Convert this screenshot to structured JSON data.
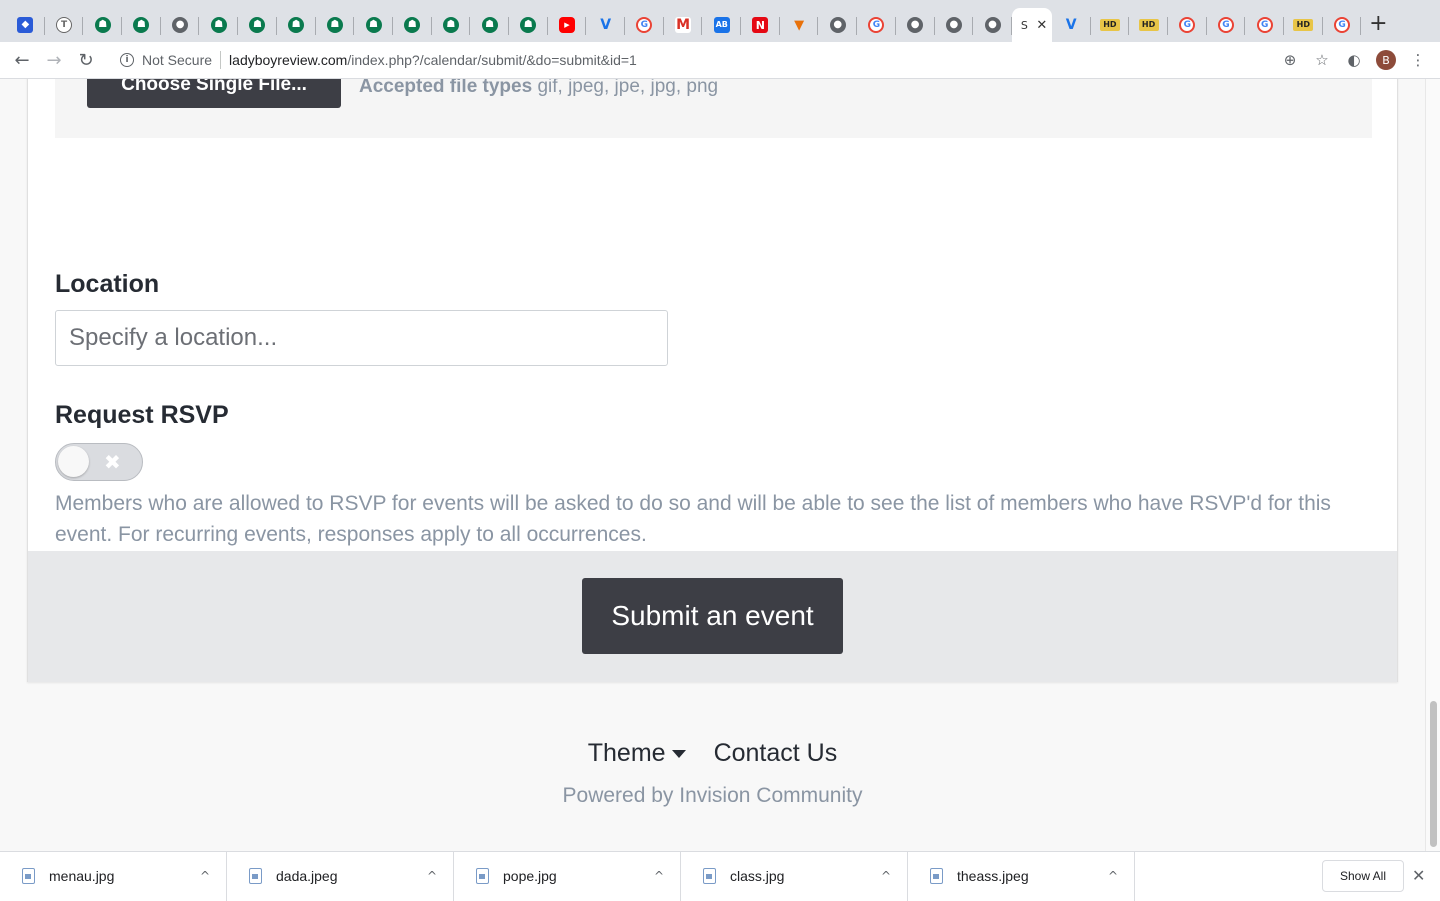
{
  "browser": {
    "tabs": [
      {
        "icon": "app-icon",
        "glyph": "◆",
        "style": "fav-blue"
      },
      {
        "icon": "t-icon",
        "glyph": "T",
        "style": "fav-t"
      },
      {
        "icon": "green-logo-icon",
        "glyph": "☗",
        "style": "fav-circle-green"
      },
      {
        "icon": "green-logo-icon",
        "glyph": "☗",
        "style": "fav-circle-green"
      },
      {
        "icon": "globe-icon",
        "glyph": "●",
        "style": "fav-globe"
      },
      {
        "icon": "green-logo-icon",
        "glyph": "☗",
        "style": "fav-circle-green"
      },
      {
        "icon": "green-logo-icon",
        "glyph": "☗",
        "style": "fav-circle-green"
      },
      {
        "icon": "green-logo-icon",
        "glyph": "☗",
        "style": "fav-circle-green"
      },
      {
        "icon": "green-logo-icon",
        "glyph": "☗",
        "style": "fav-circle-green"
      },
      {
        "icon": "green-logo-icon",
        "glyph": "☗",
        "style": "fav-circle-green"
      },
      {
        "icon": "green-logo-icon",
        "glyph": "☗",
        "style": "fav-circle-green"
      },
      {
        "icon": "green-logo-icon",
        "glyph": "☗",
        "style": "fav-circle-green"
      },
      {
        "icon": "green-logo-icon",
        "glyph": "☗",
        "style": "fav-circle-green"
      },
      {
        "icon": "green-logo-icon",
        "glyph": "☗",
        "style": "fav-circle-green"
      },
      {
        "icon": "youtube-icon",
        "glyph": "▶",
        "style": "fav-yt"
      },
      {
        "icon": "v-icon",
        "glyph": "V",
        "style": "fav-v"
      },
      {
        "icon": "google-icon",
        "glyph": "G",
        "style": "fav-g"
      },
      {
        "icon": "gmail-icon",
        "glyph": "M",
        "style": "fav-m"
      },
      {
        "icon": "ab-icon",
        "glyph": "AB",
        "style": "fav-ab"
      },
      {
        "icon": "netflix-icon",
        "glyph": "N",
        "style": "fav-n"
      },
      {
        "icon": "orange-logo-icon",
        "glyph": "▼",
        "style": "fav-orange"
      },
      {
        "icon": "globe-icon",
        "glyph": "●",
        "style": "fav-globe"
      },
      {
        "icon": "google-icon",
        "glyph": "G",
        "style": "fav-g"
      },
      {
        "icon": "globe-icon",
        "glyph": "●",
        "style": "fav-globe"
      },
      {
        "icon": "globe-icon",
        "glyph": "●",
        "style": "fav-globe"
      },
      {
        "icon": "globe-icon",
        "glyph": "●",
        "style": "fav-globe"
      },
      {
        "icon": "page-icon",
        "glyph": "S",
        "style": "fav-s",
        "active": true
      },
      {
        "icon": "v-icon",
        "glyph": "V",
        "style": "fav-v"
      },
      {
        "icon": "hd-icon",
        "glyph": "HD",
        "style": "fav-hd"
      },
      {
        "icon": "hd-icon",
        "glyph": "HD",
        "style": "fav-hd"
      },
      {
        "icon": "google-icon",
        "glyph": "G",
        "style": "fav-g"
      },
      {
        "icon": "google-icon",
        "glyph": "G",
        "style": "fav-g"
      },
      {
        "icon": "google-icon",
        "glyph": "G",
        "style": "fav-g"
      },
      {
        "icon": "hd-icon",
        "glyph": "HD",
        "style": "fav-hd"
      },
      {
        "icon": "google-icon",
        "glyph": "G",
        "style": "fav-g"
      }
    ],
    "new_tab_glyph": "+",
    "close_glyph": "✕",
    "security_label": "Not Secure",
    "url_host": "ladyboyreview.com",
    "url_path": "/index.php?/calendar/submit/&do=submit&id=1",
    "profile_initial": "B"
  },
  "upload": {
    "button_label": "Choose Single File...",
    "accepted_label": "Accepted file types",
    "accepted_types": "gif, jpeg, jpe, jpg, png"
  },
  "location": {
    "label": "Location",
    "placeholder": "Specify a location..."
  },
  "rsvp": {
    "label": "Request RSVP",
    "enabled": false,
    "help_text": "Members who are allowed to RSVP for events will be asked to do so and will be able to see the list of members who have RSVP'd for this event. For recurring events, responses apply to all occurrences."
  },
  "form": {
    "submit_label": "Submit an event"
  },
  "footer": {
    "theme_label": "Theme",
    "contact_label": "Contact Us",
    "powered_by": "Powered by Invision Community"
  },
  "downloads": {
    "items": [
      {
        "name": "menau.jpg"
      },
      {
        "name": "dada.jpeg"
      },
      {
        "name": "pope.jpg"
      },
      {
        "name": "class.jpg"
      },
      {
        "name": "theass.jpeg"
      }
    ],
    "show_all_label": "Show All"
  }
}
